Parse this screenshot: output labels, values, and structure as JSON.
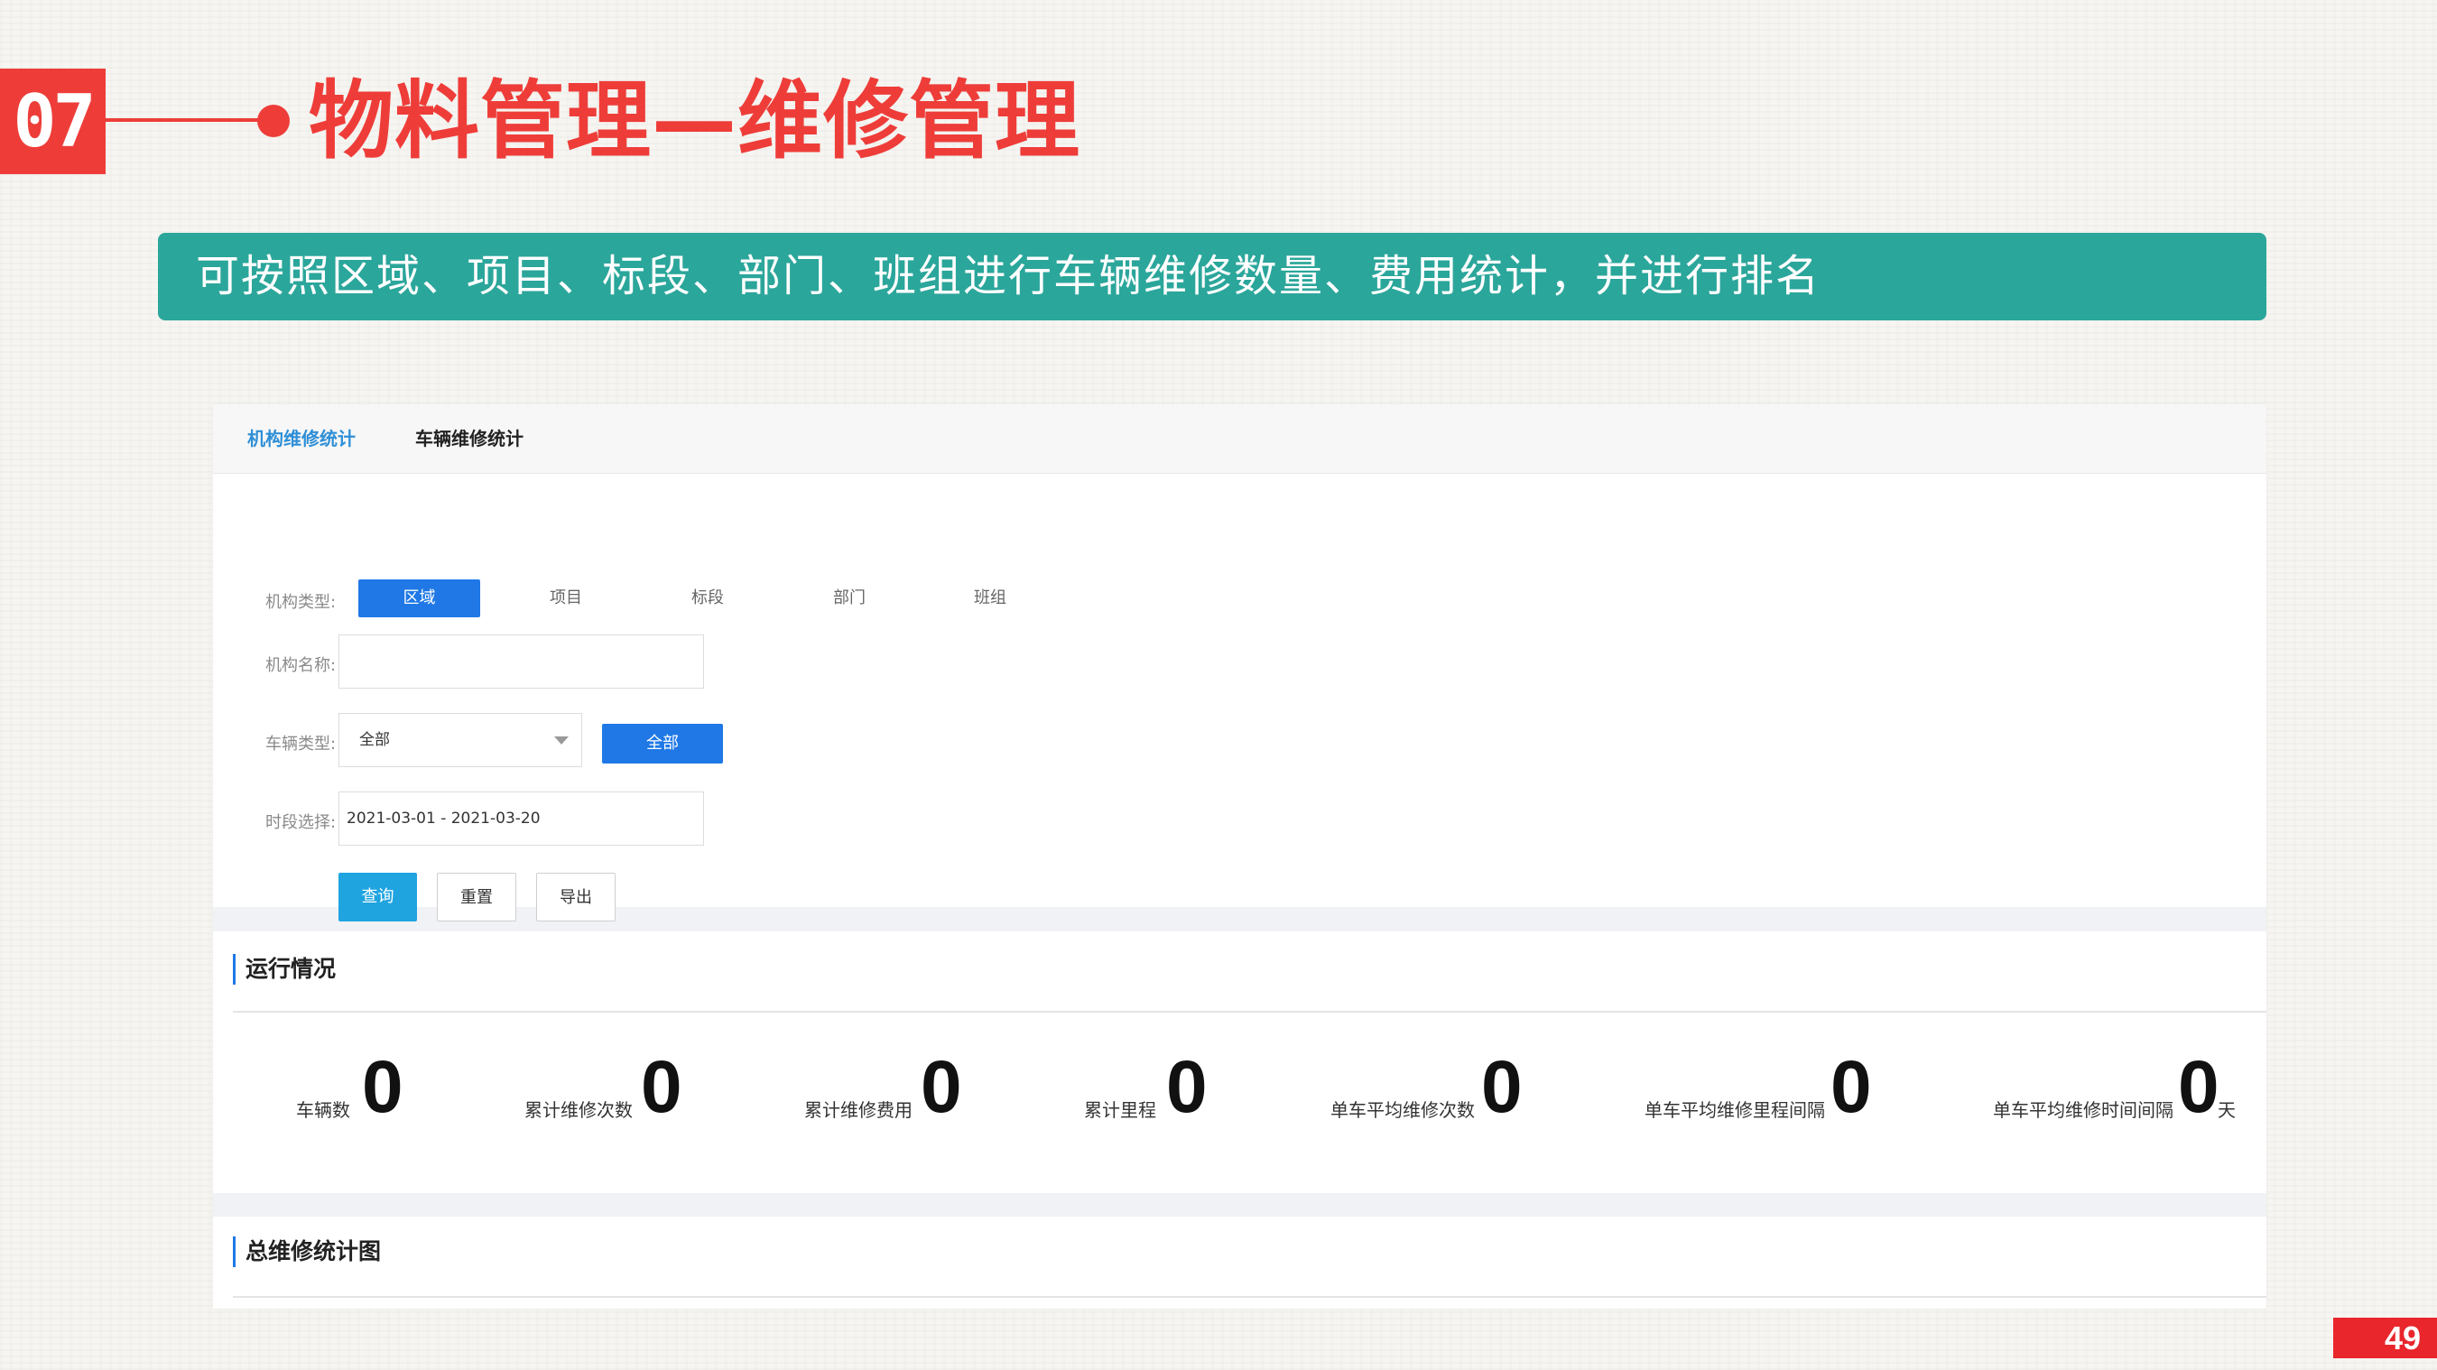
{
  "header": {
    "section_number": "07",
    "title": "物料管理—维修管理"
  },
  "banner": {
    "text": "可按照区域、项目、标段、部门、班组进行车辆维修数量、费用统计，并进行排名"
  },
  "app": {
    "tabs": [
      {
        "label": "机构维修统计",
        "active": true
      },
      {
        "label": "车辆维修统计",
        "active": false
      }
    ],
    "filter": {
      "org_type_label": "机构类型:",
      "org_types": [
        "区域",
        "项目",
        "标段",
        "部门",
        "班组"
      ],
      "org_type_selected": "区域",
      "org_name_label": "机构名称:",
      "org_name_value": "",
      "vehicle_type_label": "车辆类型:",
      "vehicle_type_value": "全部",
      "vehicle_all_button": "全部",
      "period_label": "时段选择:",
      "period_value": "2021-03-01 - 2021-03-20",
      "query_button": "查询",
      "reset_button": "重置",
      "export_button": "导出"
    },
    "operation": {
      "title": "运行情况",
      "stats": [
        {
          "label": "车辆数",
          "value": "0",
          "unit": ""
        },
        {
          "label": "累计维修次数",
          "value": "0",
          "unit": ""
        },
        {
          "label": "累计维修费用",
          "value": "0",
          "unit": ""
        },
        {
          "label": "累计里程",
          "value": "0",
          "unit": ""
        },
        {
          "label": "单车平均维修次数",
          "value": "0",
          "unit": ""
        },
        {
          "label": "单车平均维修里程间隔",
          "value": "0",
          "unit": ""
        },
        {
          "label": "单车平均维修时间间隔",
          "value": "0",
          "unit": "天"
        }
      ]
    },
    "chart_section": {
      "title": "总维修统计图"
    }
  },
  "page_number": "49",
  "colors": {
    "accent_red": "#ee3d39",
    "banner_teal": "#2ba69b",
    "primary_blue": "#1f78e6",
    "query_blue": "#1fa4e0",
    "tab_active_blue": "#2f8fd6",
    "page_badge_red": "#e8262b"
  }
}
